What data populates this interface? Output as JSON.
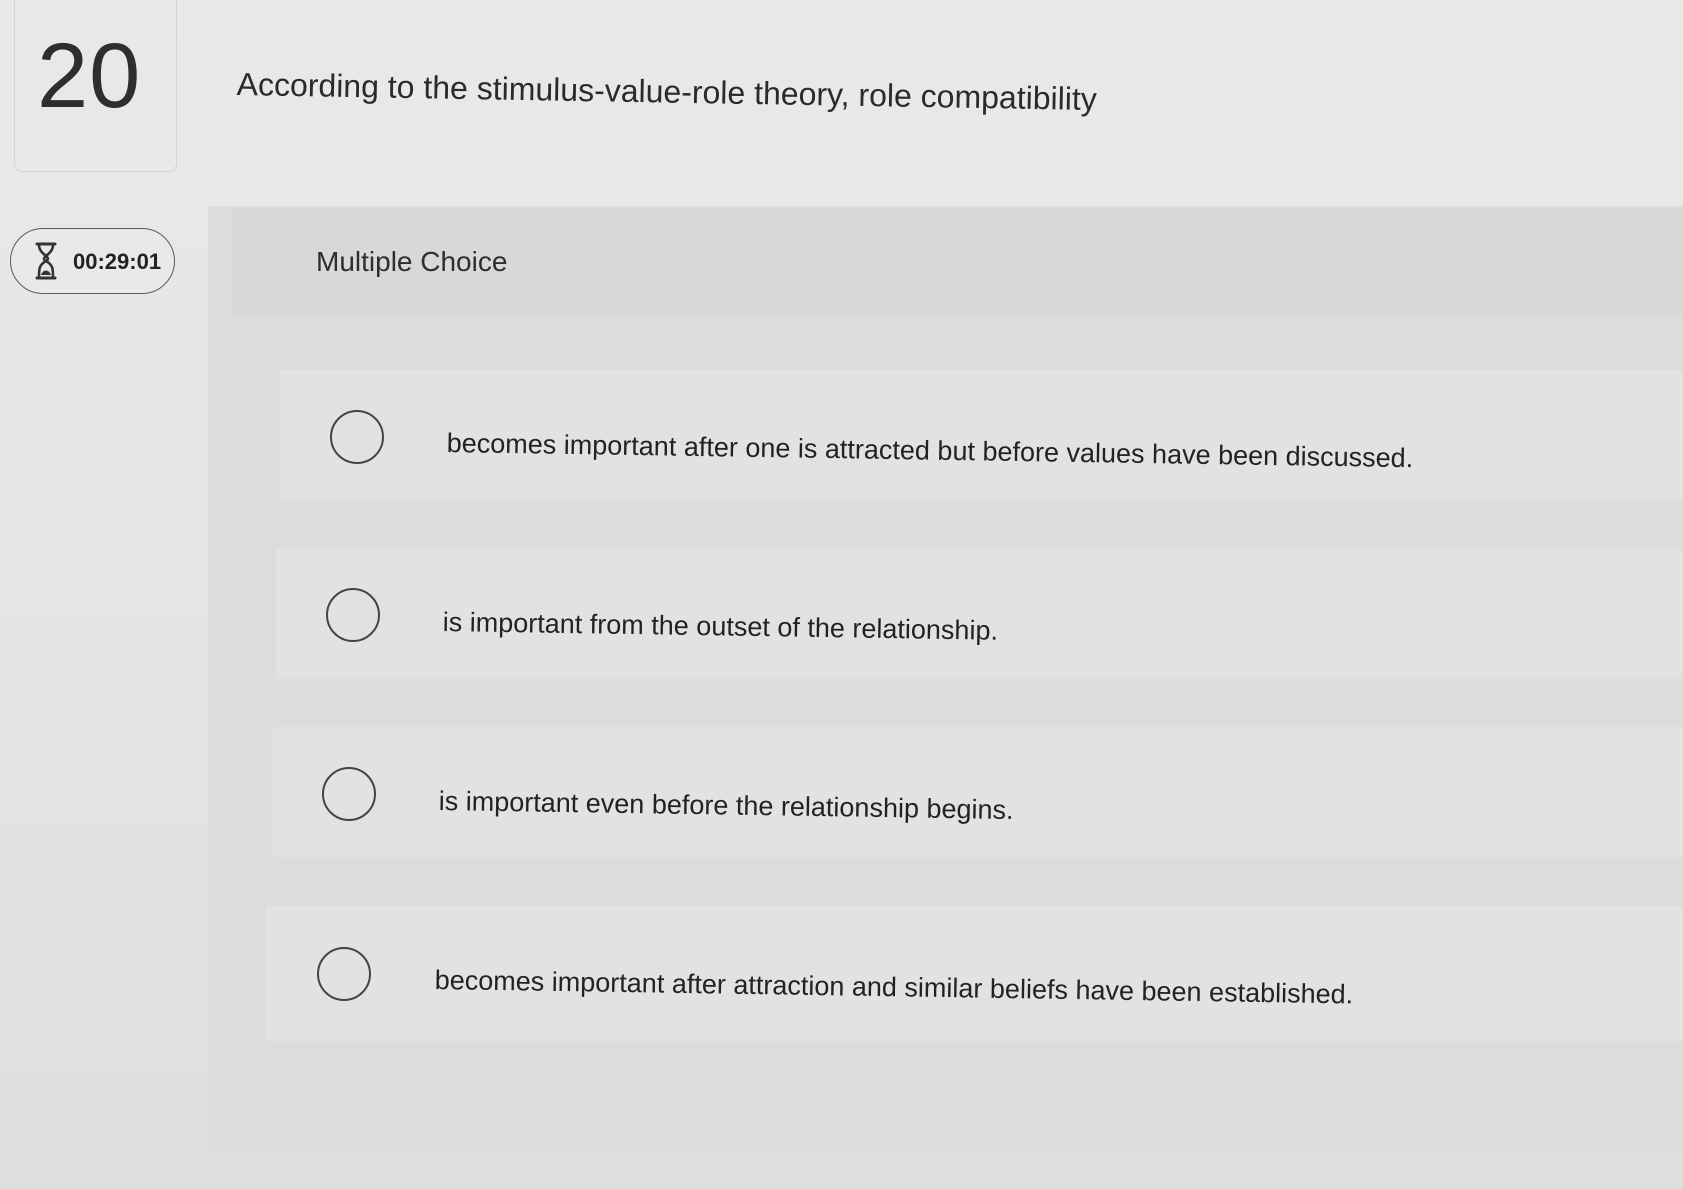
{
  "question": {
    "number": "20",
    "text": "According to the stimulus-value-role theory, role compatibility"
  },
  "timer": {
    "icon": "hourglass-icon",
    "value": "00:29:01"
  },
  "answer_section": {
    "type_label": "Multiple Choice",
    "options": [
      {
        "label": "becomes important after one is attracted but before values have been discussed.",
        "selected": false
      },
      {
        "label": "is important from the outset of the relationship.",
        "selected": false
      },
      {
        "label": "is important even before the relationship begins.",
        "selected": false
      },
      {
        "label": "becomes important after attraction and similar beliefs have been established.",
        "selected": false
      }
    ]
  }
}
